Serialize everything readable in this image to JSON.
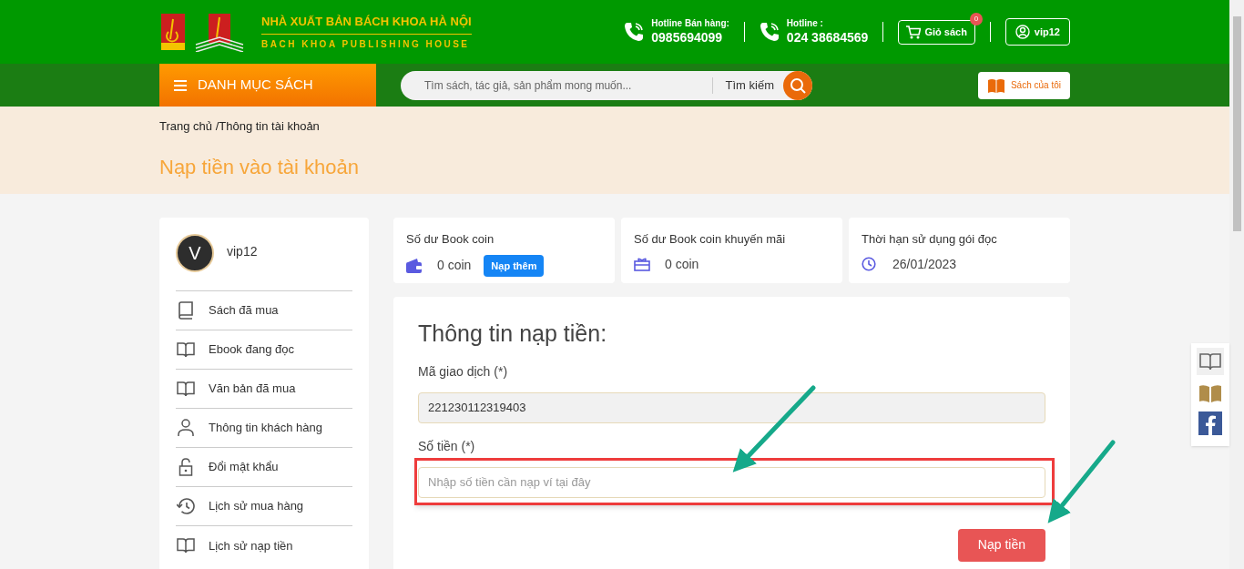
{
  "header": {
    "brand_title": "NHÀ XUẤT BẢN BÁCH KHOA HÀ NỘI",
    "brand_subtitle": "BACH KHOA PUBLISHING HOUSE",
    "hotlines": [
      {
        "label": "Hotline Bán hàng:",
        "number": "0985694099"
      },
      {
        "label": "Hotline :",
        "number": "024 38684569"
      }
    ],
    "cart": {
      "label": "Giỏ sách",
      "count": "0"
    },
    "user": {
      "label": "vip12"
    }
  },
  "nav": {
    "menu_button": "DANH MỤC SÁCH",
    "search": {
      "placeholder": "Tìm sách, tác giả, sản phẩm mong muốn...",
      "button": "Tìm kiếm"
    },
    "my_books": "Sách của tôi"
  },
  "breadcrumb": "Trang chủ /Thông tin tài khoản",
  "page_title": "Nạp tiền vào tài khoản",
  "sidebar": {
    "avatar_letter": "V",
    "username": "vip12",
    "items": [
      {
        "kind": "book",
        "label": "Sách đã mua"
      },
      {
        "kind": "open-book",
        "label": "Ebook đang đọc"
      },
      {
        "kind": "open-book",
        "label": "Văn bản đã mua"
      },
      {
        "kind": "user",
        "label": "Thông tin khách hàng"
      },
      {
        "kind": "lock",
        "label": "Đổi mật khẩu"
      },
      {
        "kind": "history",
        "label": "Lịch sử mua hàng"
      },
      {
        "kind": "open-book",
        "label": "Lịch sử nạp tiền"
      }
    ]
  },
  "stats": [
    {
      "kind": "wallet",
      "title": "Số dư Book coin",
      "value": "0 coin",
      "action": "Nạp thêm"
    },
    {
      "kind": "gift",
      "title": "Số dư Book coin khuyến mãi",
      "value": "0 coin"
    },
    {
      "kind": "clock",
      "title": "Thời hạn sử dụng gói đọc",
      "value": "26/01/2023"
    }
  ],
  "form": {
    "title": "Thông tin nạp tiền:",
    "fields": [
      {
        "label": "Mã giao dịch (*)",
        "value": "221230112319403",
        "disabled": true
      },
      {
        "label": "Số tiền (*)",
        "placeholder": "Nhập số tiền cần nạp ví tại đây",
        "disabled": false
      }
    ],
    "submit": "Nạp tiền"
  }
}
